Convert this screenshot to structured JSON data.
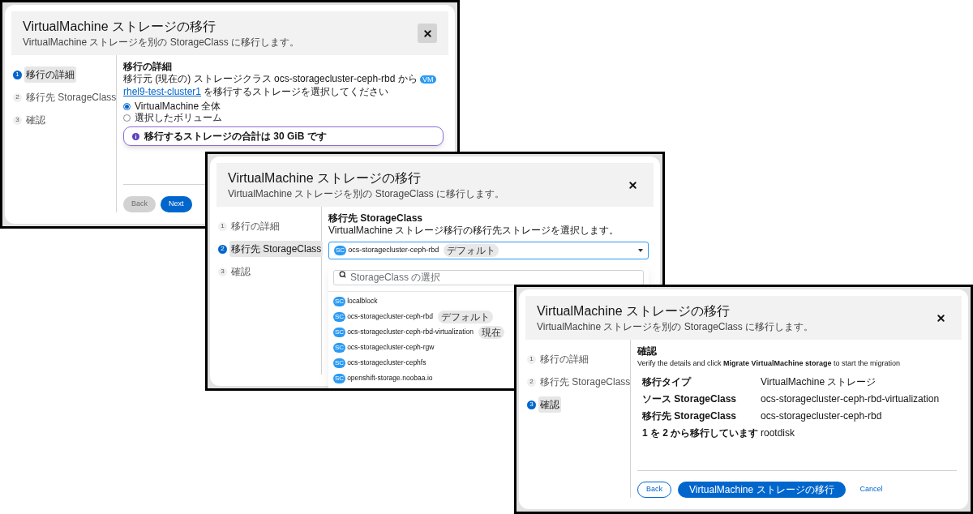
{
  "dialogs": [
    {
      "kind": "details",
      "title": "VirtualMachine ストレージの移行",
      "subtitle": "VirtualMachine ストレージを別の StorageClass に移行します。",
      "close_highlighted": true,
      "steps": [
        {
          "number": "1",
          "label": "移行の詳細",
          "selected": true
        },
        {
          "number": "2",
          "label": "移行先 StorageClass",
          "selected": false
        },
        {
          "number": "3",
          "label": "確認",
          "selected": false
        }
      ],
      "heading": "移行の詳細",
      "description_before": "移行元 (現在の) ストレージクラス ocs-storagecluster-ceph-rbd から",
      "vm_badge": "VM",
      "vm_link": "rhel9-test-cluster1",
      "description_after": "を移行するストレージを選択してください",
      "options": [
        {
          "label": "VirtualMachine 全体",
          "selected": true
        },
        {
          "label": "選択したボリューム",
          "selected": false
        }
      ],
      "alert": "移行するストレージの合計は 30 GiB です",
      "buttons": [
        {
          "kind": "secondary",
          "label": "Back",
          "disabled": true
        },
        {
          "kind": "primary",
          "label": "Next",
          "disabled": false
        }
      ]
    },
    {
      "kind": "storage_class",
      "title": "VirtualMachine ストレージの移行",
      "subtitle": "VirtualMachine ストレージを別の StorageClass に移行します。",
      "close_highlighted": false,
      "steps": [
        {
          "number": "1",
          "label": "移行の詳細",
          "selected": false
        },
        {
          "number": "2",
          "label": "移行先 StorageClass",
          "selected": true
        },
        {
          "number": "3",
          "label": "確認",
          "selected": false
        }
      ],
      "heading": "移行先 StorageClass",
      "description": "VirtualMachine ストレージ移行の移行先ストレージを選択します。",
      "select": {
        "badge": "SC",
        "value": "ocs-storagecluster-ceph-rbd",
        "tag": "デフォルト"
      },
      "search": {
        "placeholder": "StorageClass の選択"
      },
      "items": [
        {
          "badge": "SC",
          "label": "localblock"
        },
        {
          "badge": "SC",
          "label": "ocs-storagecluster-ceph-rbd",
          "tag": "デフォルト"
        },
        {
          "badge": "SC",
          "label": "ocs-storagecluster-ceph-rbd-virtualization",
          "tag": "現在"
        },
        {
          "badge": "SC",
          "label": "ocs-storagecluster-ceph-rgw"
        },
        {
          "badge": "SC",
          "label": "ocs-storagecluster-cephfs"
        },
        {
          "badge": "SC",
          "label": "openshift-storage.noobaa.io"
        }
      ]
    },
    {
      "kind": "review",
      "title": "VirtualMachine ストレージの移行",
      "subtitle": "VirtualMachine ストレージを別の StorageClass に移行します。",
      "close_highlighted": false,
      "steps": [
        {
          "number": "1",
          "label": "移行の詳細",
          "selected": false
        },
        {
          "number": "2",
          "label": "移行先 StorageClass",
          "selected": false
        },
        {
          "number": "3",
          "label": "確認",
          "selected": true
        }
      ],
      "heading": "確認",
      "description": "Verify the details and click **Migrate VirtualMachine storage** to start the migration",
      "rows": [
        {
          "label": "移行タイプ",
          "value": "VirtualMachine ストレージ"
        },
        {
          "label": "ソース StorageClass",
          "value": "ocs-storagecluster-ceph-rbd-virtualization"
        },
        {
          "label": "移行先 StorageClass",
          "value": "ocs-storagecluster-ceph-rbd"
        },
        {
          "label": "1 を 2 から移行しています",
          "value": "rootdisk"
        }
      ],
      "buttons": [
        {
          "kind": "secondary",
          "label": "Back",
          "disabled": false
        },
        {
          "kind": "primary",
          "label": "VirtualMachine ストレージの移行",
          "disabled": false
        },
        {
          "kind": "link",
          "label": "Cancel",
          "disabled": false
        }
      ]
    }
  ]
}
